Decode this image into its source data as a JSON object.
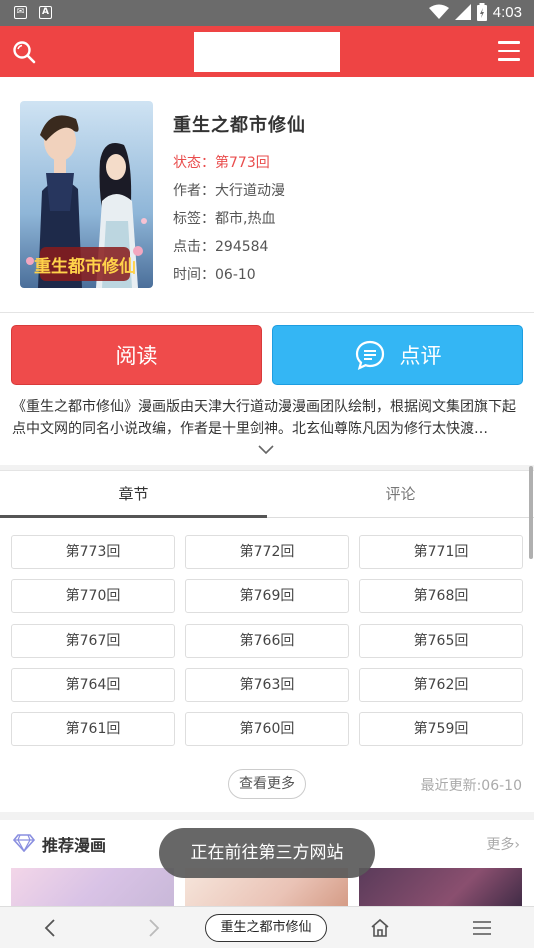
{
  "status_bar": {
    "time": "4:03"
  },
  "header": {
    "logo_alt": ""
  },
  "comic": {
    "title": "重生之都市修仙",
    "status": "状态：第773回",
    "author": "作者：大行道动漫",
    "tags": "标签：都市,热血",
    "clicks": "点击：294584",
    "time": "时间：06-10",
    "cover_text": "重生都市修仙"
  },
  "actions": {
    "read_label": "阅读",
    "review_label": "点评"
  },
  "description": "《重生之都市修仙》漫画版由天津大行道动漫漫画团队绘制，根据阅文集团旗下起点中文网的同名小说改编，作者是十里剑神。北玄仙尊陈凡因为修行太快渡…",
  "tabs": {
    "chapters": "章节",
    "comments": "评论"
  },
  "chapters": [
    "第773回",
    "第772回",
    "第771回",
    "第770回",
    "第769回",
    "第768回",
    "第767回",
    "第766回",
    "第765回",
    "第764回",
    "第763回",
    "第762回",
    "第761回",
    "第760回",
    "第759回"
  ],
  "chapter_footer": {
    "more": "查看更多",
    "updated": "最近更新:06-10"
  },
  "recommend": {
    "title": "推荐漫画",
    "more": "更多"
  },
  "toast": "正在前往第三方网站",
  "bottom_nav": {
    "page_title": "重生之都市修仙"
  },
  "colors": {
    "brand_red": "#ee4444",
    "review_blue": "#34b6f4",
    "status_red": "#e94d4d"
  }
}
